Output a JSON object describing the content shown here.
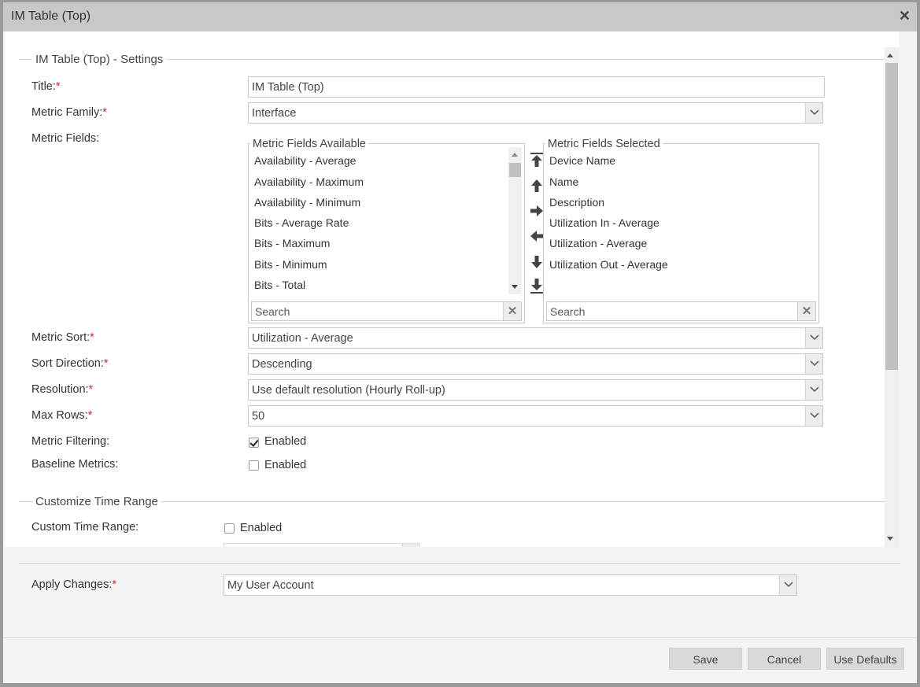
{
  "dialog": {
    "title": "IM Table (Top)",
    "close_icon": "close-icon"
  },
  "settings": {
    "legend": "IM Table (Top) - Settings",
    "title_label": "Title:",
    "title_value": "IM Table (Top)",
    "metric_family_label": "Metric Family:",
    "metric_family_value": "Interface",
    "metric_fields_label": "Metric Fields:",
    "available": {
      "title": "Metric Fields Available",
      "items": [
        "Availability - Average",
        "Availability - Maximum",
        "Availability - Minimum",
        "Bits - Average Rate",
        "Bits - Maximum",
        "Bits - Minimum",
        "Bits - Total"
      ],
      "search_placeholder": "Search"
    },
    "selected": {
      "title": "Metric Fields Selected",
      "items": [
        "Device Name",
        "Name",
        "Description",
        "Utilization In - Average",
        "Utilization - Average",
        "Utilization Out - Average"
      ],
      "search_placeholder": "Search"
    },
    "metric_sort_label": "Metric Sort:",
    "metric_sort_value": "Utilization - Average",
    "sort_direction_label": "Sort Direction:",
    "sort_direction_value": "Descending",
    "resolution_label": "Resolution:",
    "resolution_value": "Use default resolution (Hourly Roll-up)",
    "max_rows_label": "Max Rows:",
    "max_rows_value": "50",
    "metric_filtering_label": "Metric Filtering:",
    "metric_filtering_checked": true,
    "metric_filtering_text": "Enabled",
    "baseline_metrics_label": "Baseline Metrics:",
    "baseline_metrics_checked": false,
    "baseline_metrics_text": "Enabled",
    "required_mark": "*"
  },
  "time_range": {
    "legend": "Customize Time Range",
    "custom_label": "Custom Time Range:",
    "custom_checked": false,
    "custom_text": "Enabled"
  },
  "apply": {
    "label": "Apply Changes:",
    "value": "My User Account"
  },
  "footer": {
    "save": "Save",
    "cancel": "Cancel",
    "use_defaults": "Use Defaults"
  },
  "colors": {
    "required": "#d9232e",
    "titlebar": "#c8c8c8",
    "button": "#d9d9d9"
  }
}
